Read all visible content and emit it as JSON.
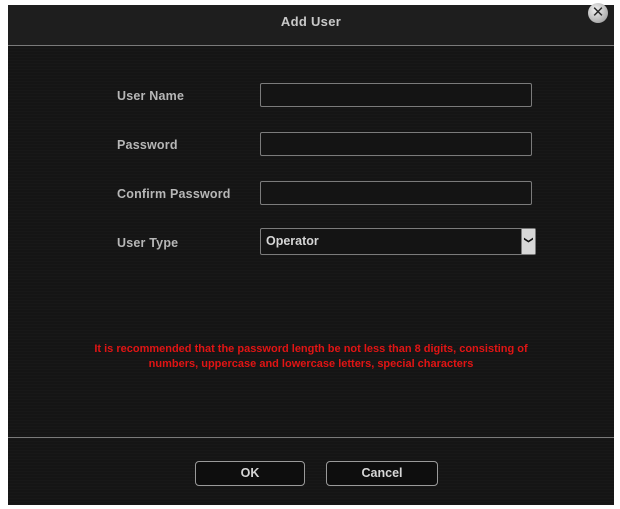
{
  "dialog": {
    "title": "Add User",
    "close_symbol": "✕"
  },
  "form": {
    "user_name": {
      "label": "User Name",
      "value": ""
    },
    "password": {
      "label": "Password",
      "value": ""
    },
    "confirm_password": {
      "label": "Confirm Password",
      "value": ""
    },
    "user_type": {
      "label": "User Type",
      "value": "Operator",
      "arrow_symbol": "❯"
    }
  },
  "warning": {
    "line1": "It is recommended that the password length be not less than 8 digits, consisting of",
    "line2": "numbers, uppercase and lowercase letters, special characters",
    "color": "#e11414"
  },
  "buttons": {
    "ok": "OK",
    "cancel": "Cancel"
  }
}
